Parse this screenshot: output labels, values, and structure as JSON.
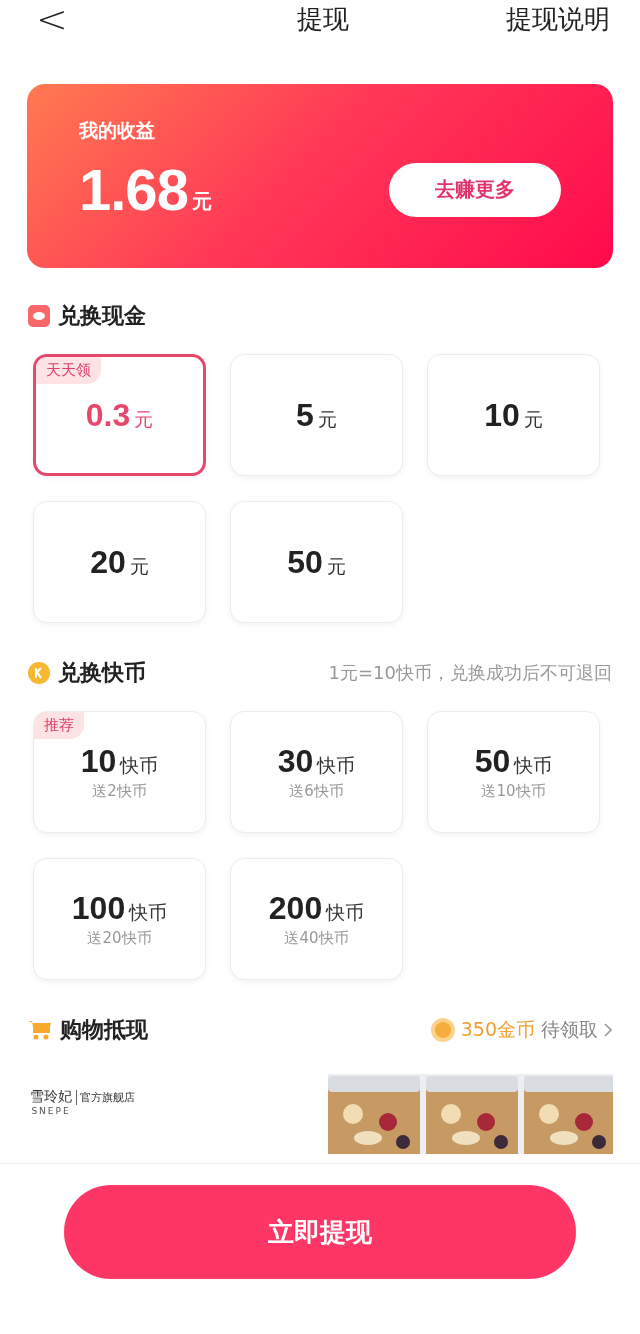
{
  "header": {
    "back": "<",
    "title": "提现",
    "action": "提现说明"
  },
  "earnings": {
    "label": "我的收益",
    "amount": "1.68",
    "unit": "元",
    "button": "去赚更多"
  },
  "cash": {
    "title": "兑换现金",
    "options": [
      {
        "amount": "0.3",
        "unit": "元",
        "tag": "天天领",
        "selected": true
      },
      {
        "amount": "5",
        "unit": "元",
        "selected": false
      },
      {
        "amount": "10",
        "unit": "元",
        "selected": false
      },
      {
        "amount": "20",
        "unit": "元",
        "selected": false
      },
      {
        "amount": "50",
        "unit": "元",
        "selected": false
      }
    ]
  },
  "coins": {
    "title": "兑换快币",
    "note": "1元=10快币，兑换成功后不可退回",
    "options": [
      {
        "amount": "10",
        "unit": "快币",
        "bonus": "送2快币",
        "tag": "推荐",
        "selected": false
      },
      {
        "amount": "30",
        "unit": "快币",
        "bonus": "送6快币",
        "selected": false
      },
      {
        "amount": "50",
        "unit": "快币",
        "bonus": "送10快币",
        "selected": false
      },
      {
        "amount": "100",
        "unit": "快币",
        "bonus": "送20快币",
        "selected": false
      },
      {
        "amount": "200",
        "unit": "快币",
        "bonus": "送40快币",
        "selected": false
      }
    ]
  },
  "shopping": {
    "title": "购物抵现",
    "reward": "350金币",
    "reward_status": "待领取",
    "brand": "雪玲妃",
    "brand_sub": "SNEPE",
    "store": "官方旗舰店"
  },
  "submit": "立即提现"
}
